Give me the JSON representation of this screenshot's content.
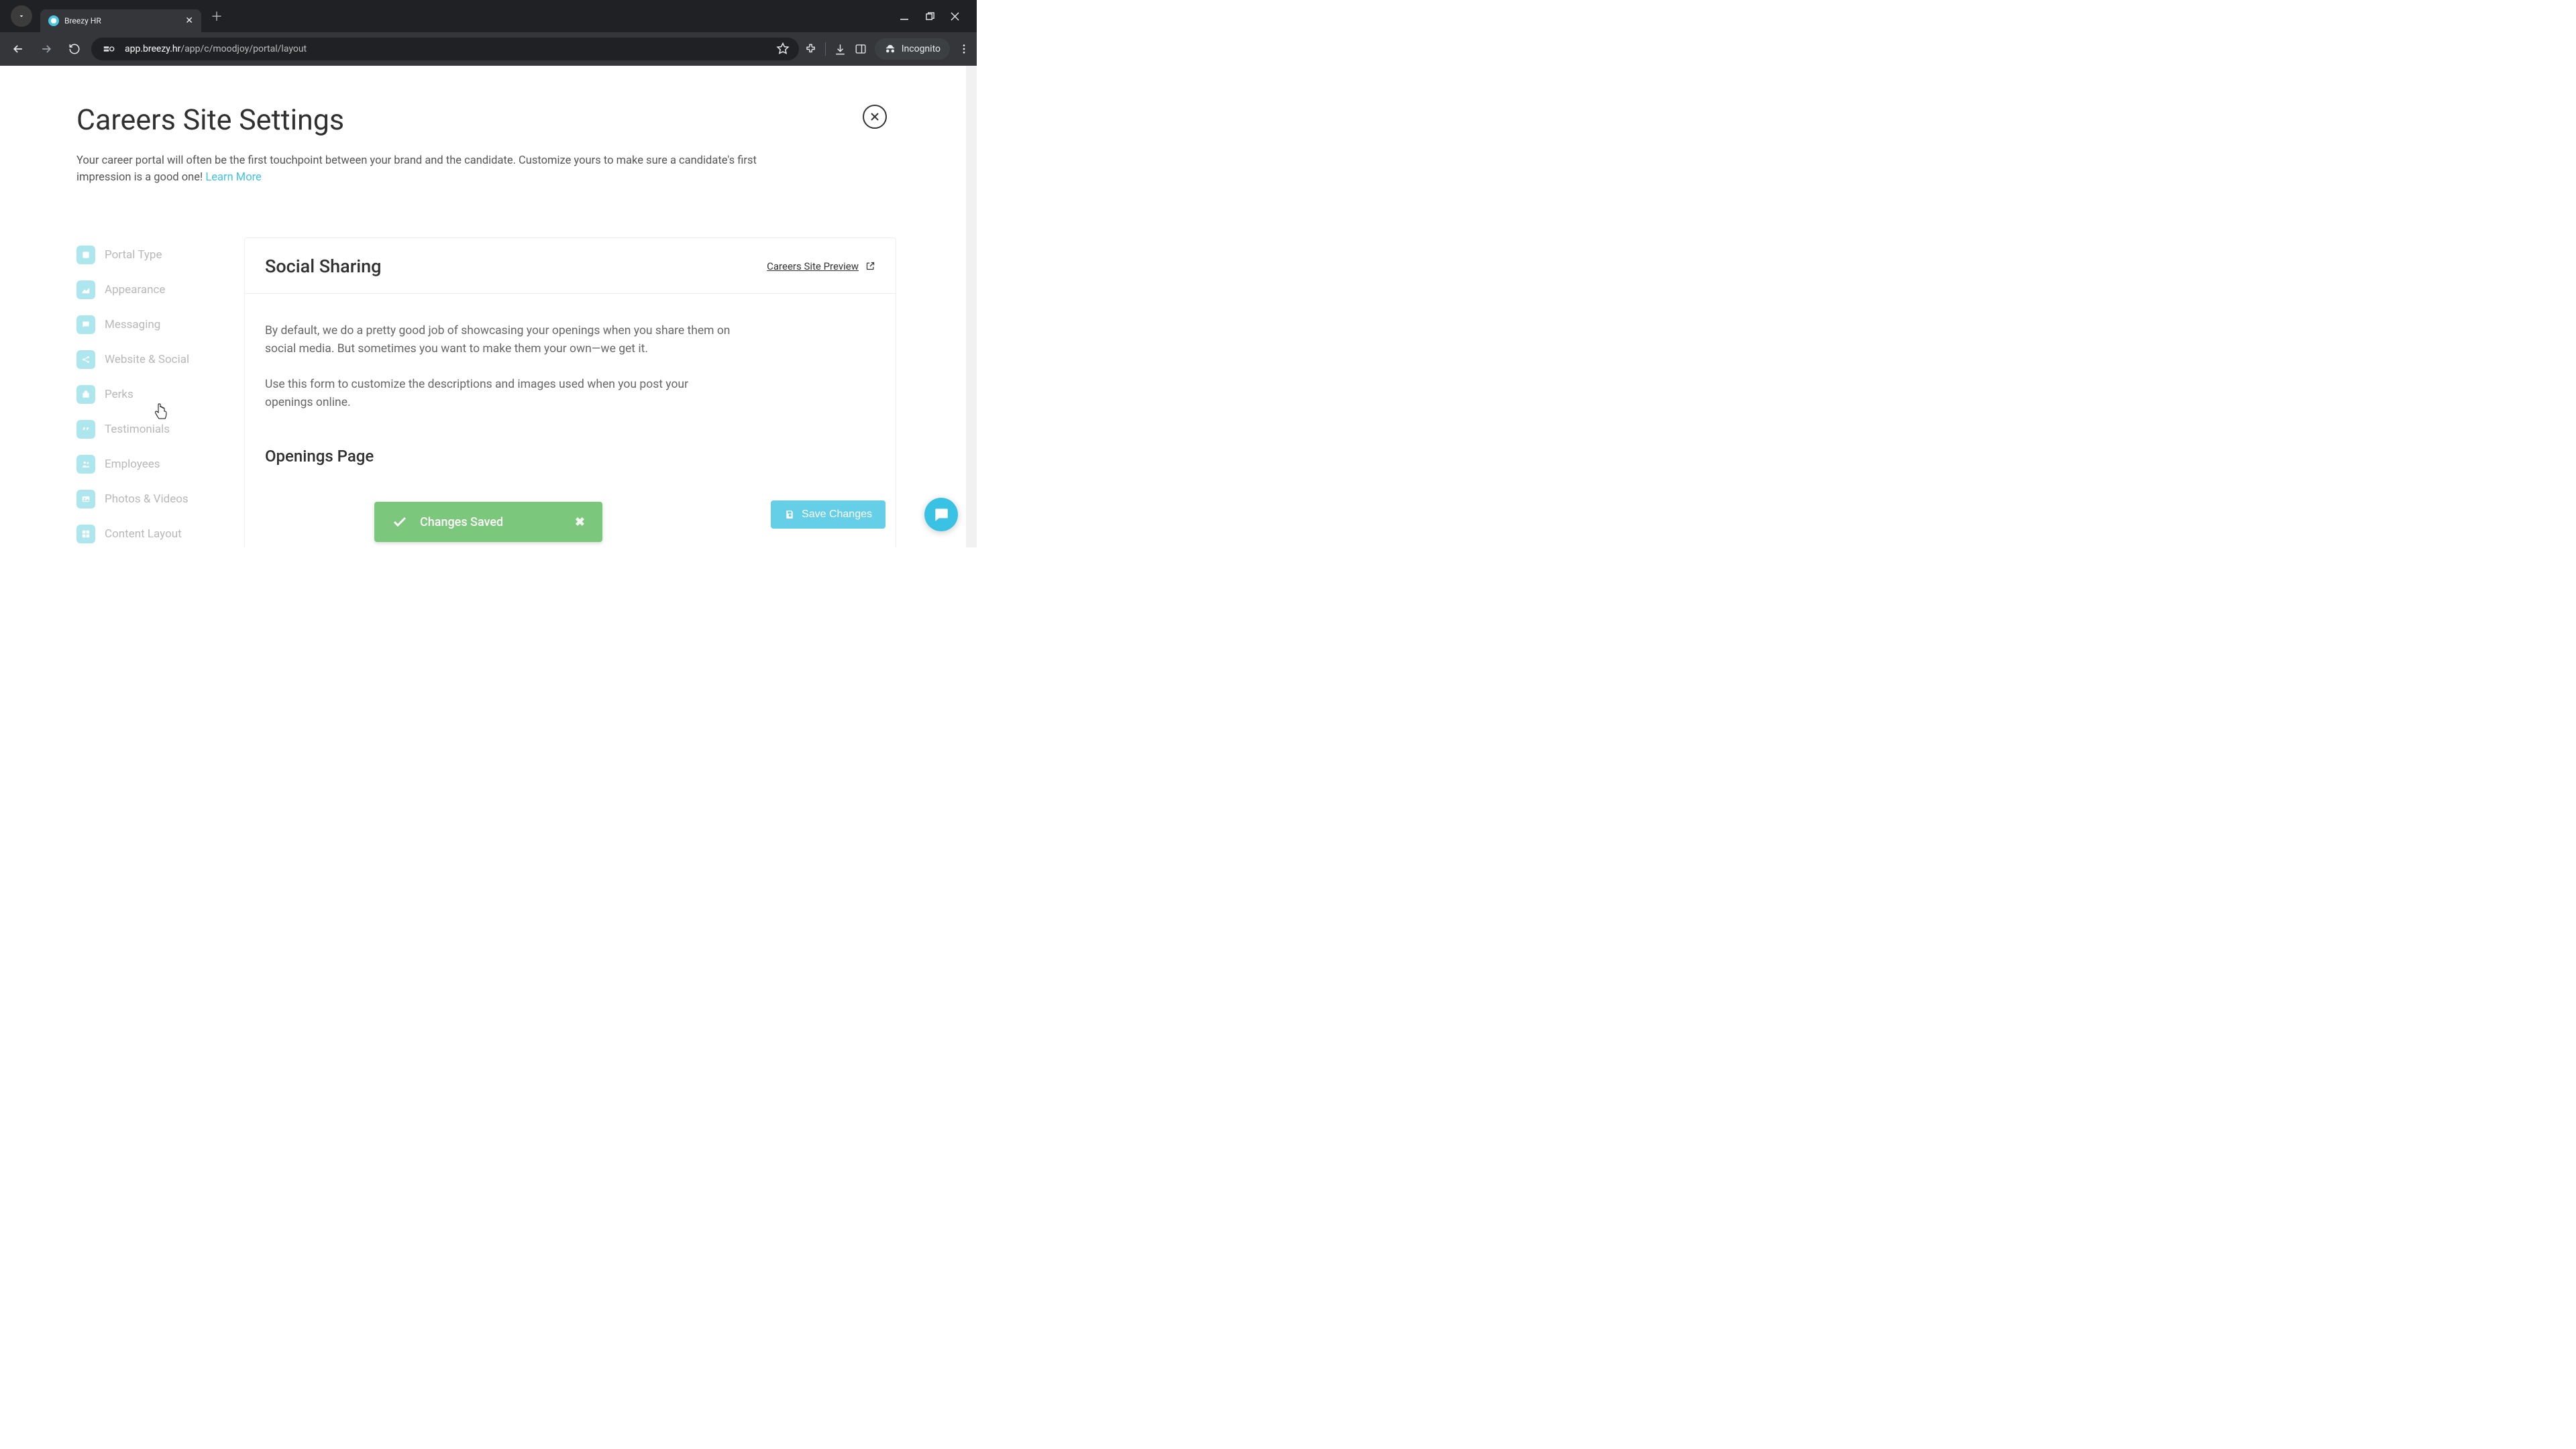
{
  "browser": {
    "tab_title": "Breezy HR",
    "url_domain": "app.breezy.hr",
    "url_path": "/app/c/moodjoy/portal/layout",
    "incognito_label": "Incognito"
  },
  "page": {
    "title": "Careers Site Settings",
    "description": "Your career portal will often be the first touchpoint between your brand and the candidate. Customize yours to make sure a candidate's first impression is a good one! ",
    "learn_more": "Learn More"
  },
  "sidebar": {
    "items": [
      {
        "label": "Portal Type"
      },
      {
        "label": "Appearance"
      },
      {
        "label": "Messaging"
      },
      {
        "label": "Website & Social"
      },
      {
        "label": "Perks"
      },
      {
        "label": "Testimonials"
      },
      {
        "label": "Employees"
      },
      {
        "label": "Photos & Videos"
      },
      {
        "label": "Content Layout"
      }
    ]
  },
  "content": {
    "section_title": "Social Sharing",
    "preview_label": "Careers Site Preview",
    "body_p1": "By default, we do a pretty good job of showcasing your openings when you share them on social media. But sometimes you want to make them your own—we get it.",
    "body_p2": "Use this form to customize the descriptions and images used when you post your openings online.",
    "subsection": "Openings Page"
  },
  "toast": {
    "message": "Changes Saved"
  },
  "actions": {
    "save_label": "Save Changes"
  }
}
